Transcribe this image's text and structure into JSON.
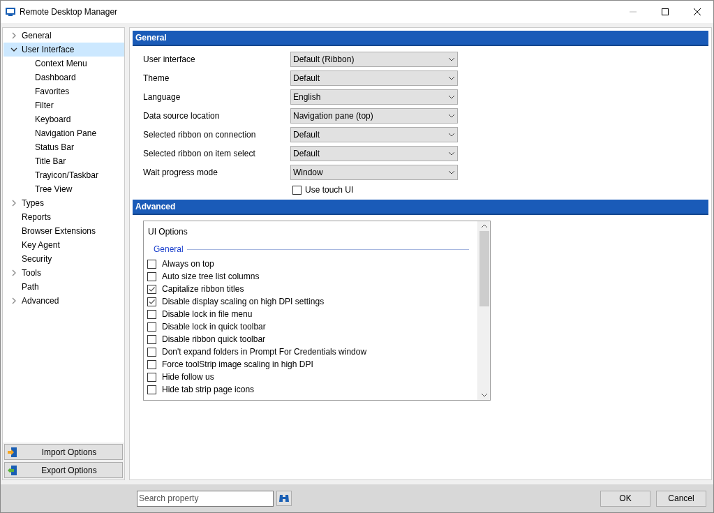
{
  "window": {
    "title": "Remote Desktop Manager"
  },
  "sidebar": {
    "items": [
      {
        "label": "General",
        "kind": "branch",
        "expanded": false,
        "selected": false
      },
      {
        "label": "User Interface",
        "kind": "branch",
        "expanded": true,
        "selected": true,
        "children": [
          {
            "label": "Context Menu",
            "selected": false
          },
          {
            "label": "Dashboard",
            "selected": false
          },
          {
            "label": "Favorites",
            "selected": false
          },
          {
            "label": "Filter",
            "selected": false
          },
          {
            "label": "Keyboard",
            "selected": false
          },
          {
            "label": "Navigation Pane",
            "selected": false
          },
          {
            "label": "Status Bar",
            "selected": false
          },
          {
            "label": "Title Bar",
            "selected": false
          },
          {
            "label": "Trayicon/Taskbar",
            "selected": false
          },
          {
            "label": "Tree View",
            "selected": false
          }
        ]
      },
      {
        "label": "Types",
        "kind": "branch",
        "expanded": false,
        "selected": false
      },
      {
        "label": "Reports",
        "kind": "leaf",
        "selected": false
      },
      {
        "label": "Browser Extensions",
        "kind": "leaf",
        "selected": false
      },
      {
        "label": "Key Agent",
        "kind": "leaf",
        "selected": false
      },
      {
        "label": "Security",
        "kind": "leaf",
        "selected": false
      },
      {
        "label": "Tools",
        "kind": "branch",
        "expanded": false,
        "selected": false
      },
      {
        "label": "Path",
        "kind": "leaf",
        "selected": false
      },
      {
        "label": "Advanced",
        "kind": "branch",
        "expanded": false,
        "selected": false
      }
    ],
    "buttons": [
      {
        "label": "Import Options",
        "kind": "import"
      },
      {
        "label": "Export Options",
        "kind": "export"
      }
    ]
  },
  "general": {
    "title": "General",
    "fields": [
      {
        "label": "User interface",
        "value": "Default (Ribbon)"
      },
      {
        "label": "Theme",
        "value": "Default"
      },
      {
        "label": "Language",
        "value": "English"
      },
      {
        "label": "Data source location",
        "value": "Navigation pane (top)"
      },
      {
        "label": "Selected ribbon on connection",
        "value": "Default"
      },
      {
        "label": "Selected ribbon on item select",
        "value": "Default"
      },
      {
        "label": "Wait progress mode",
        "value": "Window"
      }
    ],
    "touch": {
      "label": "Use touch UI",
      "checked": false
    }
  },
  "advanced": {
    "title": "Advanced",
    "list_title": "UI Options",
    "group": "General",
    "options": [
      {
        "label": "Always on top",
        "checked": false
      },
      {
        "label": "Auto size tree list columns",
        "checked": false
      },
      {
        "label": "Capitalize ribbon titles",
        "checked": true
      },
      {
        "label": "Disable display scaling on high DPI settings",
        "checked": true
      },
      {
        "label": "Disable lock in file menu",
        "checked": false
      },
      {
        "label": "Disable lock in quick toolbar",
        "checked": false
      },
      {
        "label": "Disable ribbon quick toolbar",
        "checked": false
      },
      {
        "label": "Don't expand folders in Prompt For Credentials window",
        "checked": false
      },
      {
        "label": "Force toolStrip image scaling in high DPI",
        "checked": false
      },
      {
        "label": "Hide follow us",
        "checked": false
      },
      {
        "label": "Hide tab strip page icons",
        "checked": false
      }
    ]
  },
  "footer": {
    "search": {
      "placeholder": "Search property"
    },
    "buttons": [
      "OK",
      "Cancel"
    ]
  }
}
